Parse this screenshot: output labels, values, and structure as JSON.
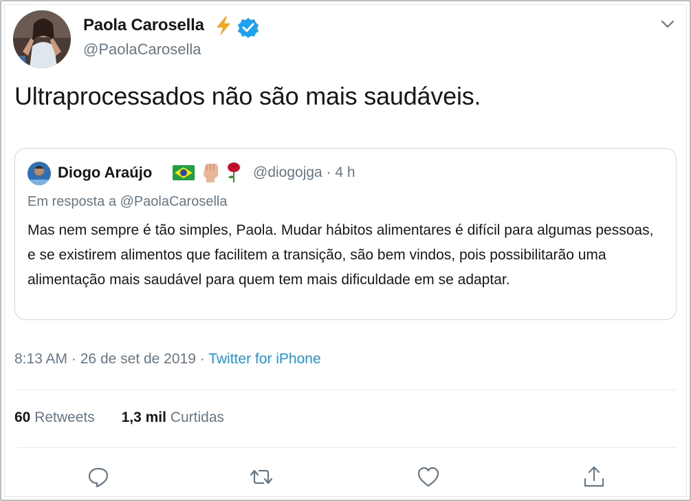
{
  "tweet": {
    "author": {
      "name": "Paola Carosella",
      "handle": "@PaolaCarosella",
      "avatar_icon": "profile-photo",
      "badges": [
        "lightning-bolt-icon",
        "verified-icon"
      ]
    },
    "text": "Ultraprocessados não são mais saudáveis.",
    "quoted": {
      "author_name": "Diogo Araújo",
      "emojis": [
        "brazil-flag-icon",
        "raised-fist-icon",
        "rose-icon"
      ],
      "handle": "@diogojga",
      "separator": "·",
      "time_ago": "4 h",
      "reply_prefix": "Em resposta a",
      "reply_to": "@PaolaCarosella",
      "body": "Mas nem sempre é tão simples, Paola. Mudar hábitos alimentares é difícil para algumas pessoas, e se existirem alimentos que facilitem a transição, são bem vindos, pois possibilitarão uma alimentação mais saudável para quem tem mais dificuldade em se adaptar."
    },
    "meta": {
      "time": "8:13 AM",
      "separator": "·",
      "date": "26 de set de 2019",
      "source": "Twitter for iPhone"
    },
    "stats": {
      "retweets_count": "60",
      "retweets_label": "Retweets",
      "likes_count": "1,3 mil",
      "likes_label": "Curtidas"
    },
    "actions": [
      "reply-icon",
      "retweet-icon",
      "like-icon",
      "share-icon"
    ]
  },
  "colors": {
    "text": "#14171a",
    "secondary": "#657786",
    "link": "#1b95e0",
    "verified": "#1da1f2",
    "border": "#ccd6dd"
  }
}
